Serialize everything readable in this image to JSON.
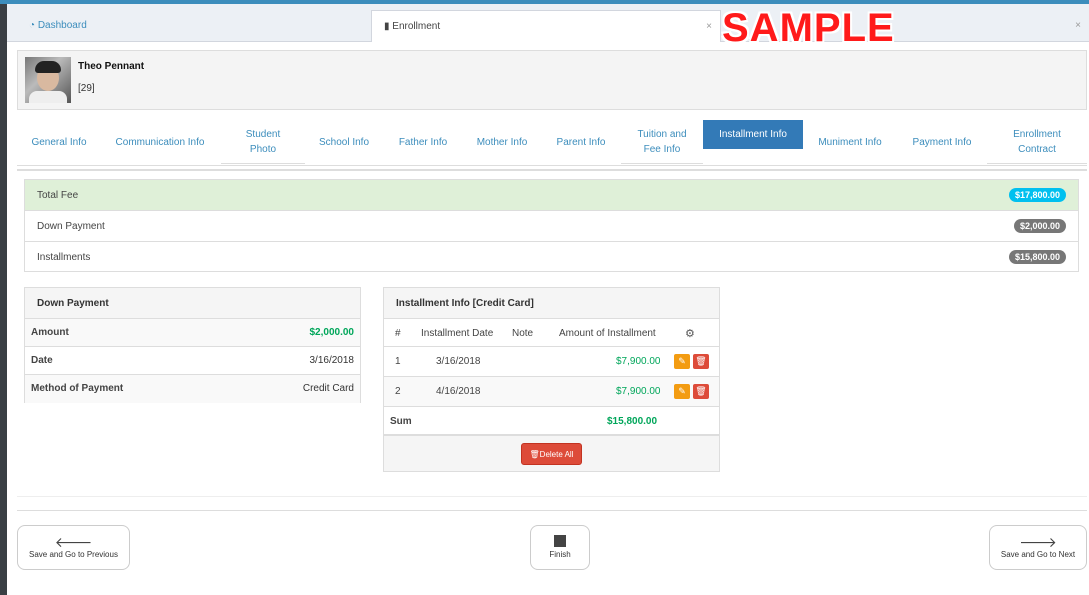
{
  "window_tabs": [
    {
      "label": "Dashboard",
      "icon": "dashboard-icon"
    },
    {
      "label": "Enrollment",
      "icon": "bookmark-icon",
      "close": "×"
    },
    {
      "label": "",
      "close": "×"
    }
  ],
  "watermark": "SAMPLE",
  "student": {
    "name": "Theo Pennant",
    "id": "[29]"
  },
  "tabs": [
    "General Info",
    "Communication Info",
    "Student Photo",
    "School Info",
    "Father Info",
    "Mother Info",
    "Parent Info",
    "Tuition and Fee Info",
    "Installment Info",
    "Muniment Info",
    "Payment Info",
    "Enrollment Contract"
  ],
  "active_tab": "Installment Info",
  "summary": [
    {
      "label": "Total Fee",
      "value": "$17,800.00"
    },
    {
      "label": "Down Payment",
      "value": "$2,000.00"
    },
    {
      "label": "Installments",
      "value": "$15,800.00"
    }
  ],
  "down_payment": {
    "title": "Down Payment",
    "rows": [
      {
        "label": "Amount",
        "value": "$2,000.00"
      },
      {
        "label": "Date",
        "value": "3/16/2018"
      },
      {
        "label": "Method of Payment",
        "value": "Credit Card"
      }
    ]
  },
  "installments": {
    "title": "Installment Info [Credit Card]",
    "columns": [
      "#",
      "Installment Date",
      "Note",
      "Amount of Installment"
    ],
    "rows": [
      {
        "num": "1",
        "date": "3/16/2018",
        "note": "",
        "amount": "$7,900.00"
      },
      {
        "num": "2",
        "date": "4/16/2018",
        "note": "",
        "amount": "$7,900.00"
      }
    ],
    "sum_label": "Sum",
    "sum_value": "$15,800.00",
    "delete_all": "Delete All"
  },
  "nav": {
    "prev": "Save and Go to Previous",
    "finish": "Finish",
    "next": "Save and Go to Next"
  }
}
